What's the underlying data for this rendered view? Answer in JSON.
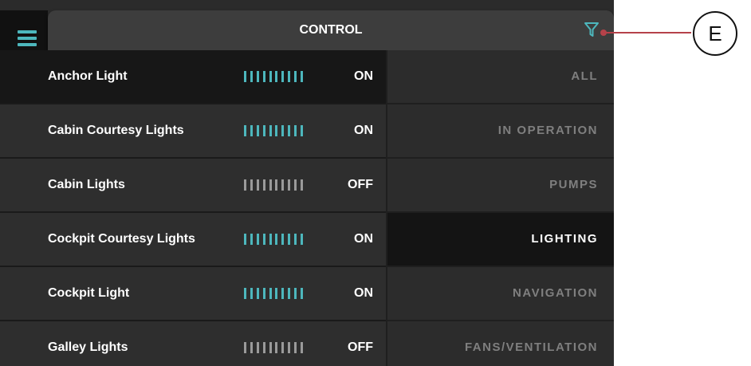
{
  "header": {
    "title": "CONTROL",
    "filter_icon": "filter-icon",
    "menu_icon": "hamburger-menu-icon"
  },
  "accent_color": "#4db7bd",
  "devices": [
    {
      "name": "Anchor Light",
      "state": "ON",
      "on": true,
      "selected": true
    },
    {
      "name": "Cabin Courtesy Lights",
      "state": "ON",
      "on": true,
      "selected": false
    },
    {
      "name": "Cabin Lights",
      "state": "OFF",
      "on": false,
      "selected": false
    },
    {
      "name": "Cockpit Courtesy Lights",
      "state": "ON",
      "on": true,
      "selected": false
    },
    {
      "name": "Cockpit Light",
      "state": "ON",
      "on": true,
      "selected": false
    },
    {
      "name": "Galley Lights",
      "state": "OFF",
      "on": false,
      "selected": false
    }
  ],
  "categories": [
    {
      "label": "ALL",
      "active": false
    },
    {
      "label": "IN OPERATION",
      "active": false
    },
    {
      "label": "PUMPS",
      "active": false
    },
    {
      "label": "LIGHTING",
      "active": true
    },
    {
      "label": "NAVIGATION",
      "active": false
    },
    {
      "label": "FANS/VENTILATION",
      "active": false
    }
  ],
  "annotation": {
    "label": "E"
  }
}
